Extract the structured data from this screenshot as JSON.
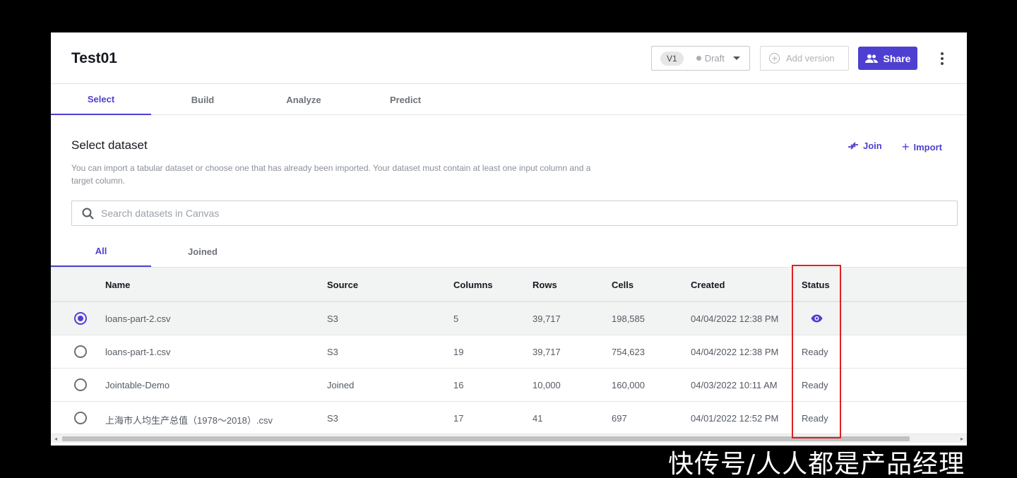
{
  "header": {
    "title": "Test01",
    "version_label": "V1",
    "draft_label": "Draft",
    "add_version_label": "Add version",
    "share_label": "Share"
  },
  "main_tabs": [
    {
      "label": "Select",
      "active": true
    },
    {
      "label": "Build",
      "active": false
    },
    {
      "label": "Analyze",
      "active": false
    },
    {
      "label": "Predict",
      "active": false
    }
  ],
  "section": {
    "title": "Select dataset",
    "description": "You can import a tabular dataset or choose one that has already been imported. Your dataset must contain at least one input column and a target column.",
    "join_label": "Join",
    "import_label": "Import"
  },
  "search": {
    "placeholder": "Search datasets in Canvas"
  },
  "sub_tabs": [
    {
      "label": "All",
      "active": true
    },
    {
      "label": "Joined",
      "active": false
    }
  ],
  "table": {
    "columns": [
      "Name",
      "Source",
      "Columns",
      "Rows",
      "Cells",
      "Created",
      "Status"
    ],
    "rows": [
      {
        "name": "loans-part-2.csv",
        "source": "S3",
        "columns": "5",
        "rows": "39,717",
        "cells": "198,585",
        "created": "04/04/2022 12:38 PM",
        "status": "",
        "status_icon": "eye-icon",
        "selected": true
      },
      {
        "name": "loans-part-1.csv",
        "source": "S3",
        "columns": "19",
        "rows": "39,717",
        "cells": "754,623",
        "created": "04/04/2022 12:38 PM",
        "status": "Ready",
        "selected": false
      },
      {
        "name": "Jointable-Demo",
        "source": "Joined",
        "columns": "16",
        "rows": "10,000",
        "cells": "160,000",
        "created": "04/03/2022 10:11 AM",
        "status": "Ready",
        "selected": false
      },
      {
        "name": "上海市人均生产总值（1978～2018）.csv",
        "source": "S3",
        "columns": "17",
        "rows": "41",
        "cells": "697",
        "created": "04/01/2022 12:52 PM",
        "status": "Ready",
        "selected": false
      }
    ]
  },
  "watermark": "快传号/人人都是产品经理",
  "colors": {
    "accent": "#4f3fd1",
    "highlight": "#e02020"
  }
}
